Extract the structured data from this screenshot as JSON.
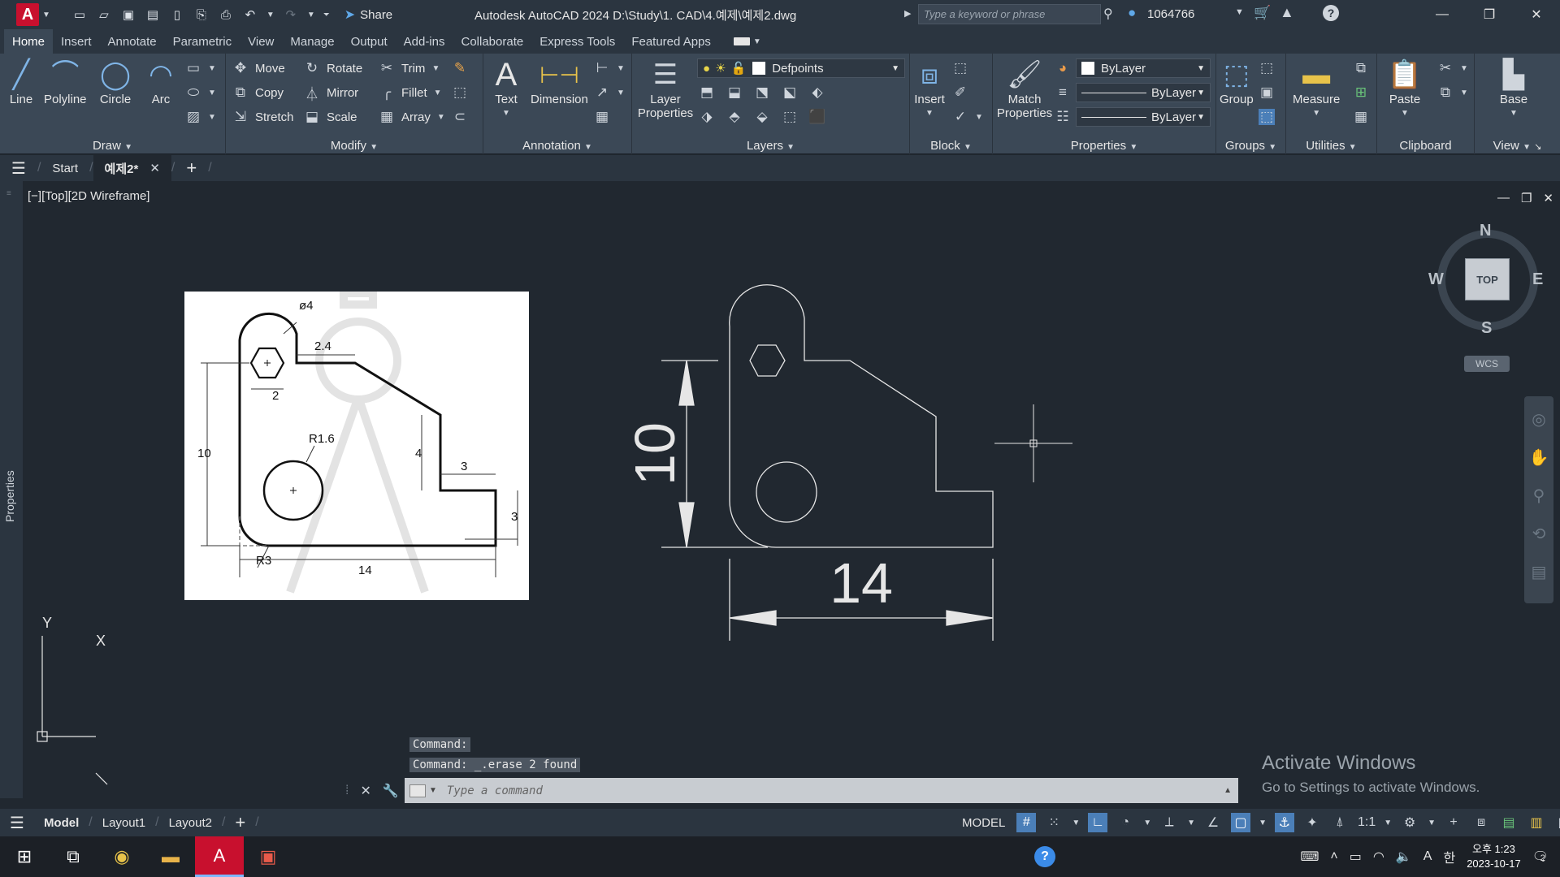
{
  "titlebar": {
    "app_logo": "A",
    "share_label": "Share",
    "title": "Autodesk AutoCAD 2024    D:\\Study\\1. CAD\\4.예제\\예제2.dwg",
    "search_placeholder": "Type a keyword or phrase",
    "user_name": "1064766"
  },
  "ribbon_tabs": [
    "Home",
    "Insert",
    "Annotate",
    "Parametric",
    "View",
    "Manage",
    "Output",
    "Add-ins",
    "Collaborate",
    "Express Tools",
    "Featured Apps"
  ],
  "ribbon": {
    "draw": {
      "title": "Draw",
      "line": "Line",
      "polyline": "Polyline",
      "circle": "Circle",
      "arc": "Arc"
    },
    "modify": {
      "title": "Modify",
      "move": "Move",
      "rotate": "Rotate",
      "trim": "Trim",
      "copy": "Copy",
      "mirror": "Mirror",
      "fillet": "Fillet",
      "stretch": "Stretch",
      "scale": "Scale",
      "array": "Array"
    },
    "annotation": {
      "title": "Annotation",
      "text": "Text",
      "dimension": "Dimension"
    },
    "layers": {
      "title": "Layers",
      "layer_properties": "Layer Properties",
      "current_layer": "Defpoints"
    },
    "block": {
      "title": "Block",
      "insert": "Insert"
    },
    "properties": {
      "title": "Properties",
      "match": "Match Properties",
      "color": "ByLayer",
      "linetype": "ByLayer",
      "lineweight": "ByLayer"
    },
    "groups": {
      "title": "Groups",
      "group": "Group"
    },
    "utilities": {
      "title": "Utilities",
      "measure": "Measure"
    },
    "clipboard": {
      "title": "Clipboard",
      "paste": "Paste"
    },
    "view": {
      "title": "View",
      "base": "Base"
    }
  },
  "file_tabs": {
    "start": "Start",
    "current": "예제2*"
  },
  "viewport": {
    "label": "[−][Top][2D Wireframe]",
    "left_panel": "Properties",
    "dims": {
      "height": "10",
      "width": "14"
    }
  },
  "reference": {
    "d4": "ø4",
    "d24": "2.4",
    "d2": "2",
    "r16": "R1.6",
    "d10": "10",
    "d4v": "4",
    "d3h": "3",
    "d3v": "3",
    "r3": "R3",
    "d14": "14"
  },
  "viewcube": {
    "top": "TOP",
    "n": "N",
    "s": "S",
    "e": "E",
    "w": "W",
    "wcs": "WCS"
  },
  "ucs": {
    "x": "X",
    "y": "Y"
  },
  "command": {
    "history": [
      "Command:",
      "Command: _.erase 2 found"
    ],
    "placeholder": "Type a command"
  },
  "watermark": {
    "title": "Activate Windows",
    "subtitle": "Go to Settings to activate Windows."
  },
  "status": {
    "tabs": [
      "Model",
      "Layout1",
      "Layout2"
    ],
    "model_label": "MODEL",
    "scale": "1:1"
  },
  "taskbar": {
    "time": "오후 1:23",
    "date": "2023-10-17",
    "ime_a": "A",
    "ime_han": "한",
    "notif_count": "2"
  }
}
